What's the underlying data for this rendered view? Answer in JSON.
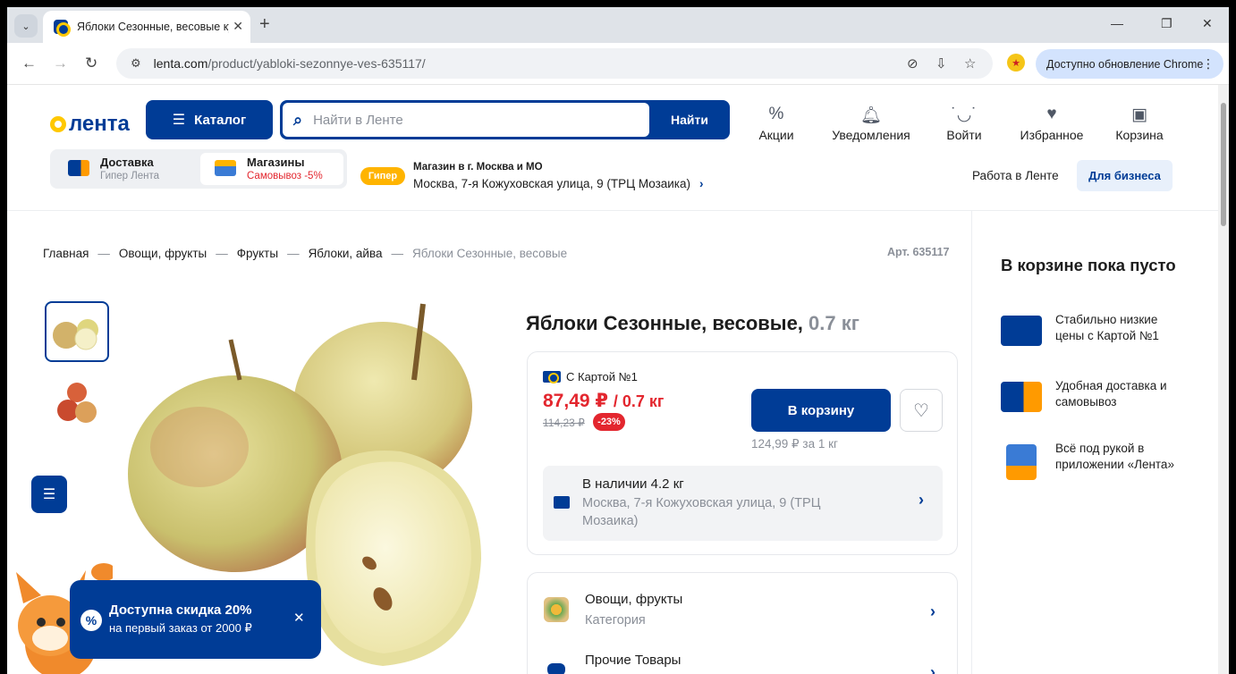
{
  "browser": {
    "tab_title": "Яблоки Сезонные, весовые ку",
    "url_host": "lenta.com",
    "url_path": "/product/yabloki-sezonnye-ves-635117/",
    "update_label": "Доступно обновление Chrome"
  },
  "header": {
    "logo": "лента",
    "catalog_label": "Каталог",
    "search_placeholder": "Найти в Ленте",
    "search_button": "Найти",
    "icons": [
      {
        "label": "Акции",
        "icon": "percent-icon"
      },
      {
        "label": "Уведомления",
        "icon": "bell-icon"
      },
      {
        "label": "Войти",
        "icon": "face-icon"
      },
      {
        "label": "Избранное",
        "icon": "heart-icon"
      },
      {
        "label": "Корзина",
        "icon": "bag-icon"
      }
    ],
    "delivery": {
      "title": "Доставка",
      "subtitle": "Гипер Лента"
    },
    "stores": {
      "title": "Магазины",
      "subtitle": "Самовывоз -5%"
    },
    "store_badge": "Гипер",
    "store_region": "Магазин в г. Москва и МО",
    "store_address": "Москва, 7-я Кожуховская улица, 9 (ТРЦ Мозаика)",
    "work_link": "Работа в Ленте",
    "business_button": "Для бизнеса"
  },
  "breadcrumbs": [
    "Главная",
    "Овощи, фрукты",
    "Фрукты",
    "Яблоки, айва",
    "Яблоки Сезонные, весовые"
  ],
  "article": "Арт. 635117",
  "product": {
    "title": "Яблоки Сезонные, весовые,",
    "weight": "0.7 кг",
    "card_label": "С Картой №1",
    "price": "87,49 ₽",
    "price_weight": "/ 0.7 кг",
    "old_price": "114,23 ₽",
    "discount": "-23%",
    "cart_button": "В корзину",
    "price_per_kg": "124,99 ₽ за 1 кг",
    "availability": "В наличии 4.2 кг",
    "availability_address": "Москва, 7-я Кожуховская улица, 9 (ТРЦ Мозаика)"
  },
  "categories": [
    {
      "title": "Овощи, фрукты",
      "subtitle": "Категория"
    },
    {
      "title": "Прочие Товары",
      "subtitle": ""
    }
  ],
  "cart_panel": {
    "title": "В корзине пока пусто",
    "perks": [
      "Стабильно низкие цены с Картой №1",
      "Удобная доставка и самовывоз",
      "Всё под рукой в приложении «Лента»"
    ]
  },
  "promo": {
    "title": "Доступна скидка 20%",
    "subtitle": "на первый заказ от 2000 ₽"
  },
  "colors": {
    "brand": "#003c96",
    "accent": "#ffc800",
    "sale": "#e3262e"
  }
}
